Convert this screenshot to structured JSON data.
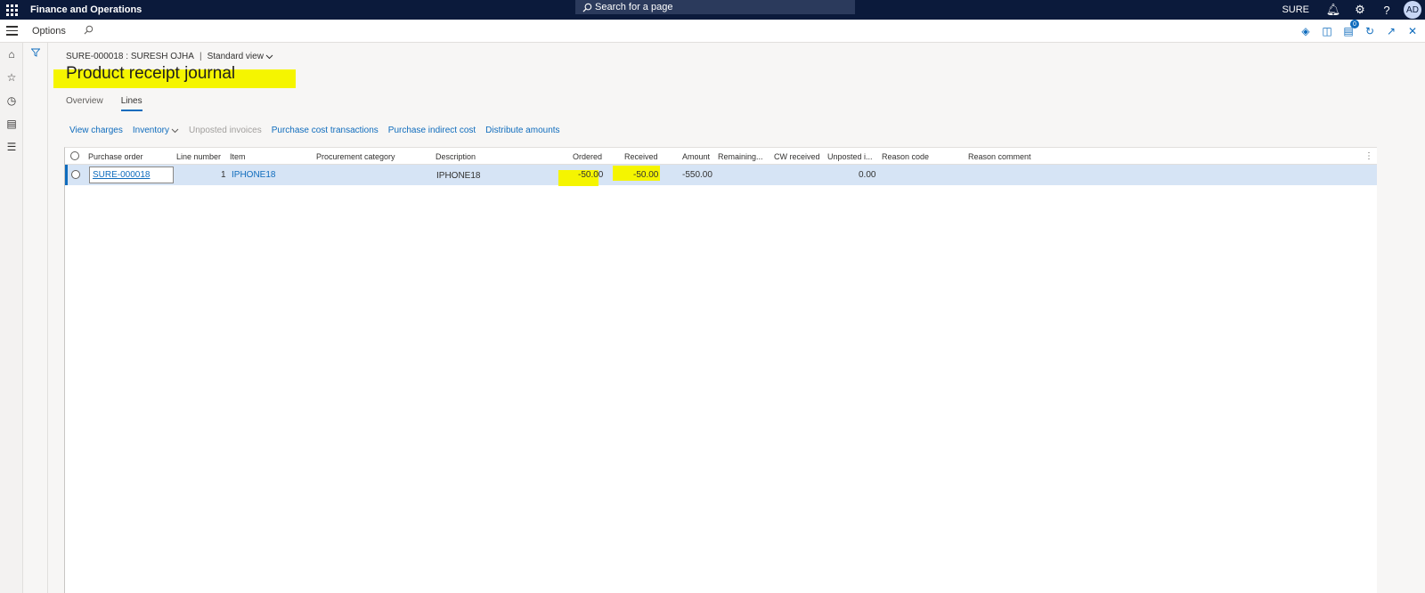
{
  "app": {
    "title": "Finance and Operations",
    "search_placeholder": "Search for a page",
    "company": "SURE",
    "user_initials": "AD"
  },
  "command_bar": {
    "options_label": "Options"
  },
  "page": {
    "breadcrumb_record": "SURE-000018 : SURESH OJHA",
    "breadcrumb_separator": "|",
    "view_label": "Standard view",
    "title": "Product receipt journal",
    "tabs": [
      {
        "label": "Overview",
        "active": false
      },
      {
        "label": "Lines",
        "active": true
      }
    ]
  },
  "actions": {
    "view_charges": "View charges",
    "inventory": "Inventory",
    "unposted_invoices": "Unposted invoices",
    "purchase_cost_transactions": "Purchase cost transactions",
    "purchase_indirect_cost": "Purchase indirect cost",
    "distribute_amounts": "Distribute amounts"
  },
  "grid": {
    "columns": {
      "purchase_order": "Purchase order",
      "line_number": "Line number",
      "item": "Item",
      "procurement_category": "Procurement category",
      "description": "Description",
      "ordered": "Ordered",
      "received": "Received",
      "amount": "Amount",
      "remaining": "Remaining...",
      "cw_received": "CW received",
      "unposted": "Unposted i...",
      "reason_code": "Reason code",
      "reason_comment": "Reason comment"
    },
    "rows": [
      {
        "purchase_order": "SURE-000018",
        "line_number": "1",
        "item": "IPHONE18",
        "procurement_category": "",
        "description": "IPHONE18",
        "ordered": "-50.00",
        "received": "-50.00",
        "amount": "-550.00",
        "remaining": "",
        "cw_received": "",
        "unposted": "0.00",
        "reason_code": "",
        "reason_comment": ""
      }
    ]
  },
  "colors": {
    "topbar": "#0b1a3b",
    "accent": "#0f6cbd",
    "highlight": "#f5f500",
    "selected_row": "#d6e4f5"
  }
}
